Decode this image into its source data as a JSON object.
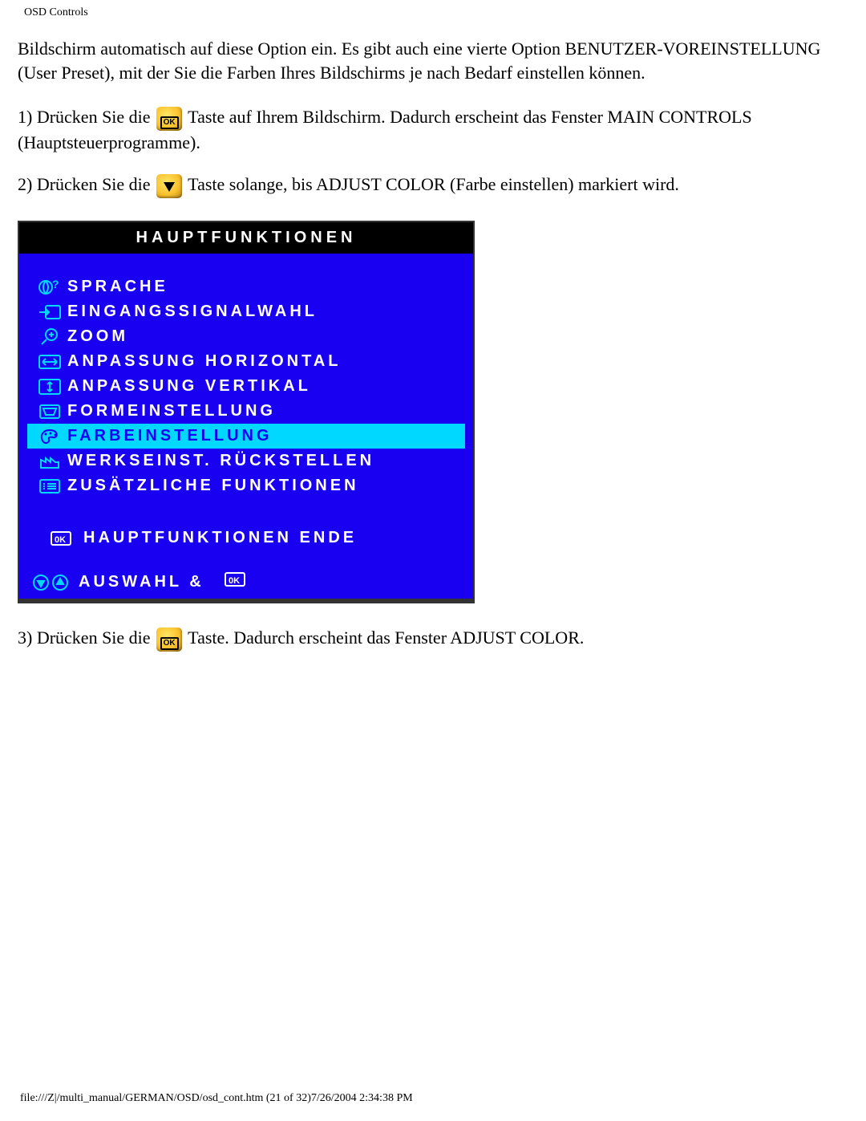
{
  "header": {
    "title": "OSD Controls"
  },
  "intro": {
    "paragraph": "Bildschirm automatisch auf diese Option ein. Es gibt auch eine vierte Option BENUTZER-VOREINSTELLUNG (User Preset), mit der Sie die Farben Ihres Bildschirms je nach Bedarf einstellen können."
  },
  "steps": {
    "s1a": "1) Drücken Sie die ",
    "s1b": " Taste auf Ihrem Bildschirm. Dadurch erscheint das Fenster MAIN CONTROLS (Hauptsteuerprogramme).",
    "s2a": "2) Drücken Sie die ",
    "s2b": " Taste solange, bis ADJUST COLOR (Farbe einstellen) markiert wird.",
    "s3a": "3) Drücken Sie die ",
    "s3b": " Taste. Dadurch erscheint das Fenster ADJUST COLOR."
  },
  "osd": {
    "title": "HAUPTFUNKTIONEN",
    "items": [
      {
        "label": "SPRACHE",
        "icon": "globe"
      },
      {
        "label": "EINGANGSSIGNALWAHL",
        "icon": "input"
      },
      {
        "label": "ZOOM",
        "icon": "zoom"
      },
      {
        "label": "ANPASSUNG HORIZONTAL",
        "icon": "horiz"
      },
      {
        "label": "ANPASSUNG VERTIKAL",
        "icon": "vert"
      },
      {
        "label": "FORMEINSTELLUNG",
        "icon": "shape"
      },
      {
        "label": "FARBEINSTELLUNG",
        "icon": "palette",
        "selected": true
      },
      {
        "label": "WERKSEINST. RÜCKSTELLEN",
        "icon": "factory"
      },
      {
        "label": "ZUSÄTZLICHE FUNKTIONEN",
        "icon": "list"
      }
    ],
    "exit": {
      "label": "HAUPTFUNKTIONEN ENDE",
      "icon": "ok-box"
    },
    "footer": {
      "label": "AUSWAHL &",
      "ok_icon": "ok-box"
    }
  },
  "footer": {
    "path": "file:///Z|/multi_manual/GERMAN/OSD/osd_cont.htm (21 of 32)7/26/2004 2:34:38 PM"
  },
  "buttons": {
    "ok": "OK"
  }
}
